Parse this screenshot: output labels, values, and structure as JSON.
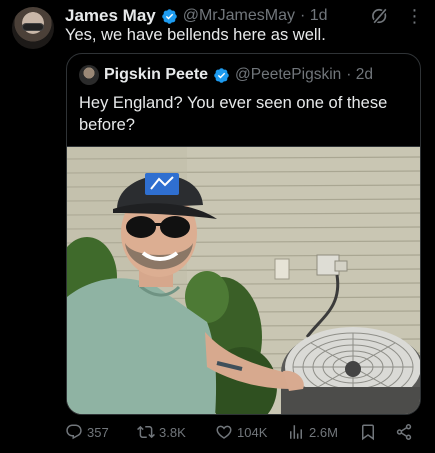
{
  "author": {
    "name": "James May",
    "handle": "@MrJamesMay",
    "time": "· 1d",
    "text": "Yes, we have bellends here as well."
  },
  "quoted": {
    "name": "Pigskin Peete",
    "handle": "@PeetePigskin",
    "time": "· 2d",
    "text": "Hey England? You ever seen one of these before?"
  },
  "metrics": {
    "replies": "357",
    "reposts": "3.8K",
    "likes": "104K",
    "views": "2.6M"
  },
  "icons": {
    "verified": "verified-badge-icon",
    "grok": "grok-icon",
    "more": "more-icon",
    "reply": "reply-icon",
    "repost": "repost-icon",
    "like": "heart-icon",
    "views": "views-icon",
    "bookmark": "bookmark-icon",
    "share": "share-icon"
  },
  "colors": {
    "background": "#000000",
    "text": "#e7e9ea",
    "secondary": "#71767b",
    "verified": "#1d9bf0",
    "border": "#2f3336"
  }
}
